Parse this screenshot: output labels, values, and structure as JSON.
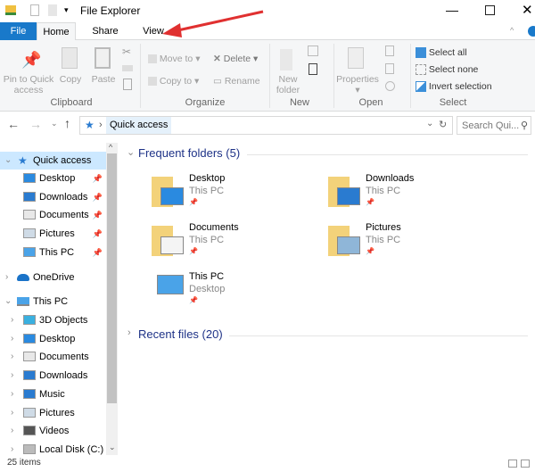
{
  "window": {
    "title": "File Explorer"
  },
  "tabs": [
    {
      "label": "File"
    },
    {
      "label": "Home"
    },
    {
      "label": "Share"
    },
    {
      "label": "View"
    }
  ],
  "ribbon": {
    "clipboard": {
      "label": "Clipboard",
      "pin": "Pin to Quick access",
      "pin_l1": "Pin to Quick",
      "pin_l2": "access",
      "copy": "Copy",
      "paste": "Paste"
    },
    "organize": {
      "label": "Organize",
      "move_to": "Move to",
      "copy_to": "Copy to",
      "delete": "Delete",
      "rename": "Rename"
    },
    "new": {
      "label": "New",
      "new_folder_l1": "New",
      "new_folder_l2": "folder"
    },
    "open": {
      "label": "Open",
      "properties": "Properties"
    },
    "select": {
      "label": "Select",
      "select_all": "Select all",
      "select_none": "Select none",
      "invert": "Invert selection"
    }
  },
  "address": {
    "path": "Quick access",
    "search_placeholder": "Search Qui..."
  },
  "nav": {
    "quick_access": "Quick access",
    "quick_items": [
      {
        "label": "Desktop",
        "icon": "desktop-icon"
      },
      {
        "label": "Downloads",
        "icon": "downloads-icon"
      },
      {
        "label": "Documents",
        "icon": "documents-icon"
      },
      {
        "label": "Pictures",
        "icon": "pictures-icon"
      },
      {
        "label": "This PC",
        "icon": "this-pc-icon"
      }
    ],
    "onedrive": "OneDrive",
    "this_pc": "This PC",
    "pc_items": [
      {
        "label": "3D Objects"
      },
      {
        "label": "Desktop"
      },
      {
        "label": "Documents"
      },
      {
        "label": "Downloads"
      },
      {
        "label": "Music"
      },
      {
        "label": "Pictures"
      },
      {
        "label": "Videos"
      },
      {
        "label": "Local Disk (C:)"
      }
    ]
  },
  "content": {
    "frequent_header": "Frequent folders (5)",
    "recent_header": "Recent files (20)",
    "folders": [
      {
        "name": "Desktop",
        "location": "This PC"
      },
      {
        "name": "Downloads",
        "location": "This PC"
      },
      {
        "name": "Documents",
        "location": "This PC"
      },
      {
        "name": "Pictures",
        "location": "This PC"
      },
      {
        "name": "This PC",
        "location": "Desktop"
      }
    ]
  },
  "status": {
    "items": "25 items"
  },
  "colors": {
    "accent": "#1979ca",
    "selection": "#cce8ff",
    "header": "#1e3287",
    "annotation_arrow": "#e03030"
  }
}
